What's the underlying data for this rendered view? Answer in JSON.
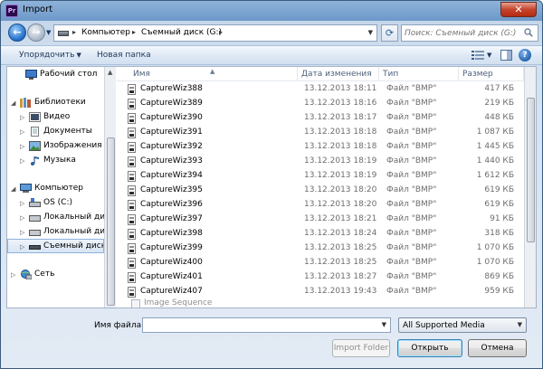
{
  "window": {
    "title": "Import",
    "app_icon": "Pr",
    "close_glyph": "✕"
  },
  "address": {
    "crumbs": [
      "Компьютер",
      "Съемный диск (G:)"
    ],
    "search_placeholder": "Поиск: Съемный диск (G:)"
  },
  "toolbar": {
    "organize": "Упорядочить",
    "new_folder": "Новая папка"
  },
  "nav": {
    "desktop": "Рабочий стол",
    "libraries": "Библиотеки",
    "video": "Видео",
    "documents": "Документы",
    "images": "Изображения",
    "music": "Музыка",
    "computer": "Компьютер",
    "os_c": "OS (C:)",
    "local_disk_1": "Локальный диск",
    "local_disk_2": "Локальный диск",
    "removable": "Съемный диск (",
    "network": "Сеть"
  },
  "columns": {
    "name": "Имя",
    "date": "Дата изменения",
    "type": "Тип",
    "size": "Размер"
  },
  "files": [
    {
      "name": "CaptureWiz388",
      "date": "13.12.2013 18:11",
      "type": "Файл \"BMP\"",
      "size": "417 КБ"
    },
    {
      "name": "CaptureWiz389",
      "date": "13.12.2013 18:16",
      "type": "Файл \"BMP\"",
      "size": "219 КБ"
    },
    {
      "name": "CaptureWiz390",
      "date": "13.12.2013 18:17",
      "type": "Файл \"BMP\"",
      "size": "448 КБ"
    },
    {
      "name": "CaptureWiz391",
      "date": "13.12.2013 18:18",
      "type": "Файл \"BMP\"",
      "size": "1 087 КБ"
    },
    {
      "name": "CaptureWiz392",
      "date": "13.12.2013 18:18",
      "type": "Файл \"BMP\"",
      "size": "1 445 КБ"
    },
    {
      "name": "CaptureWiz393",
      "date": "13.12.2013 18:19",
      "type": "Файл \"BMP\"",
      "size": "1 440 КБ"
    },
    {
      "name": "CaptureWiz394",
      "date": "13.12.2013 18:19",
      "type": "Файл \"BMP\"",
      "size": "1 612 КБ"
    },
    {
      "name": "CaptureWiz395",
      "date": "13.12.2013 18:20",
      "type": "Файл \"BMP\"",
      "size": "619 КБ"
    },
    {
      "name": "CaptureWiz396",
      "date": "13.12.2013 18:20",
      "type": "Файл \"BMP\"",
      "size": "619 КБ"
    },
    {
      "name": "CaptureWiz397",
      "date": "13.12.2013 18:21",
      "type": "Файл \"BMP\"",
      "size": "91 КБ"
    },
    {
      "name": "CaptureWiz398",
      "date": "13.12.2013 18:24",
      "type": "Файл \"BMP\"",
      "size": "318 КБ"
    },
    {
      "name": "CaptureWiz399",
      "date": "13.12.2013 18:25",
      "type": "Файл \"BMP\"",
      "size": "1 070 КБ"
    },
    {
      "name": "CaptureWiz400",
      "date": "13.12.2013 18:25",
      "type": "Файл \"BMP\"",
      "size": "1 070 КБ"
    },
    {
      "name": "CaptureWiz401",
      "date": "13.12.2013 18:27",
      "type": "Файл \"BMP\"",
      "size": "869 КБ"
    },
    {
      "name": "CaptureWiz407",
      "date": "13.12.2013 19:43",
      "type": "Файл \"BMP\"",
      "size": "959 КБ"
    }
  ],
  "bottom": {
    "image_sequence": "Image Sequence",
    "file_name_label": "Имя файла:",
    "file_name_value": "",
    "file_type": "All Supported Media",
    "import_folder": "Import Folder",
    "open": "Открыть",
    "cancel": "Отмена"
  },
  "icons": {
    "back": "arrow-left-icon",
    "forward": "arrow-right-icon",
    "refresh": "refresh-icon",
    "search": "magnifier-icon",
    "view": "view-options-icon",
    "preview_pane": "preview-pane-icon",
    "help": "help-icon",
    "file": "bmp-file-icon"
  },
  "colors": {
    "accent": "#1f6cc7",
    "selection": "#d8e5f5",
    "close": "#c4442c"
  }
}
